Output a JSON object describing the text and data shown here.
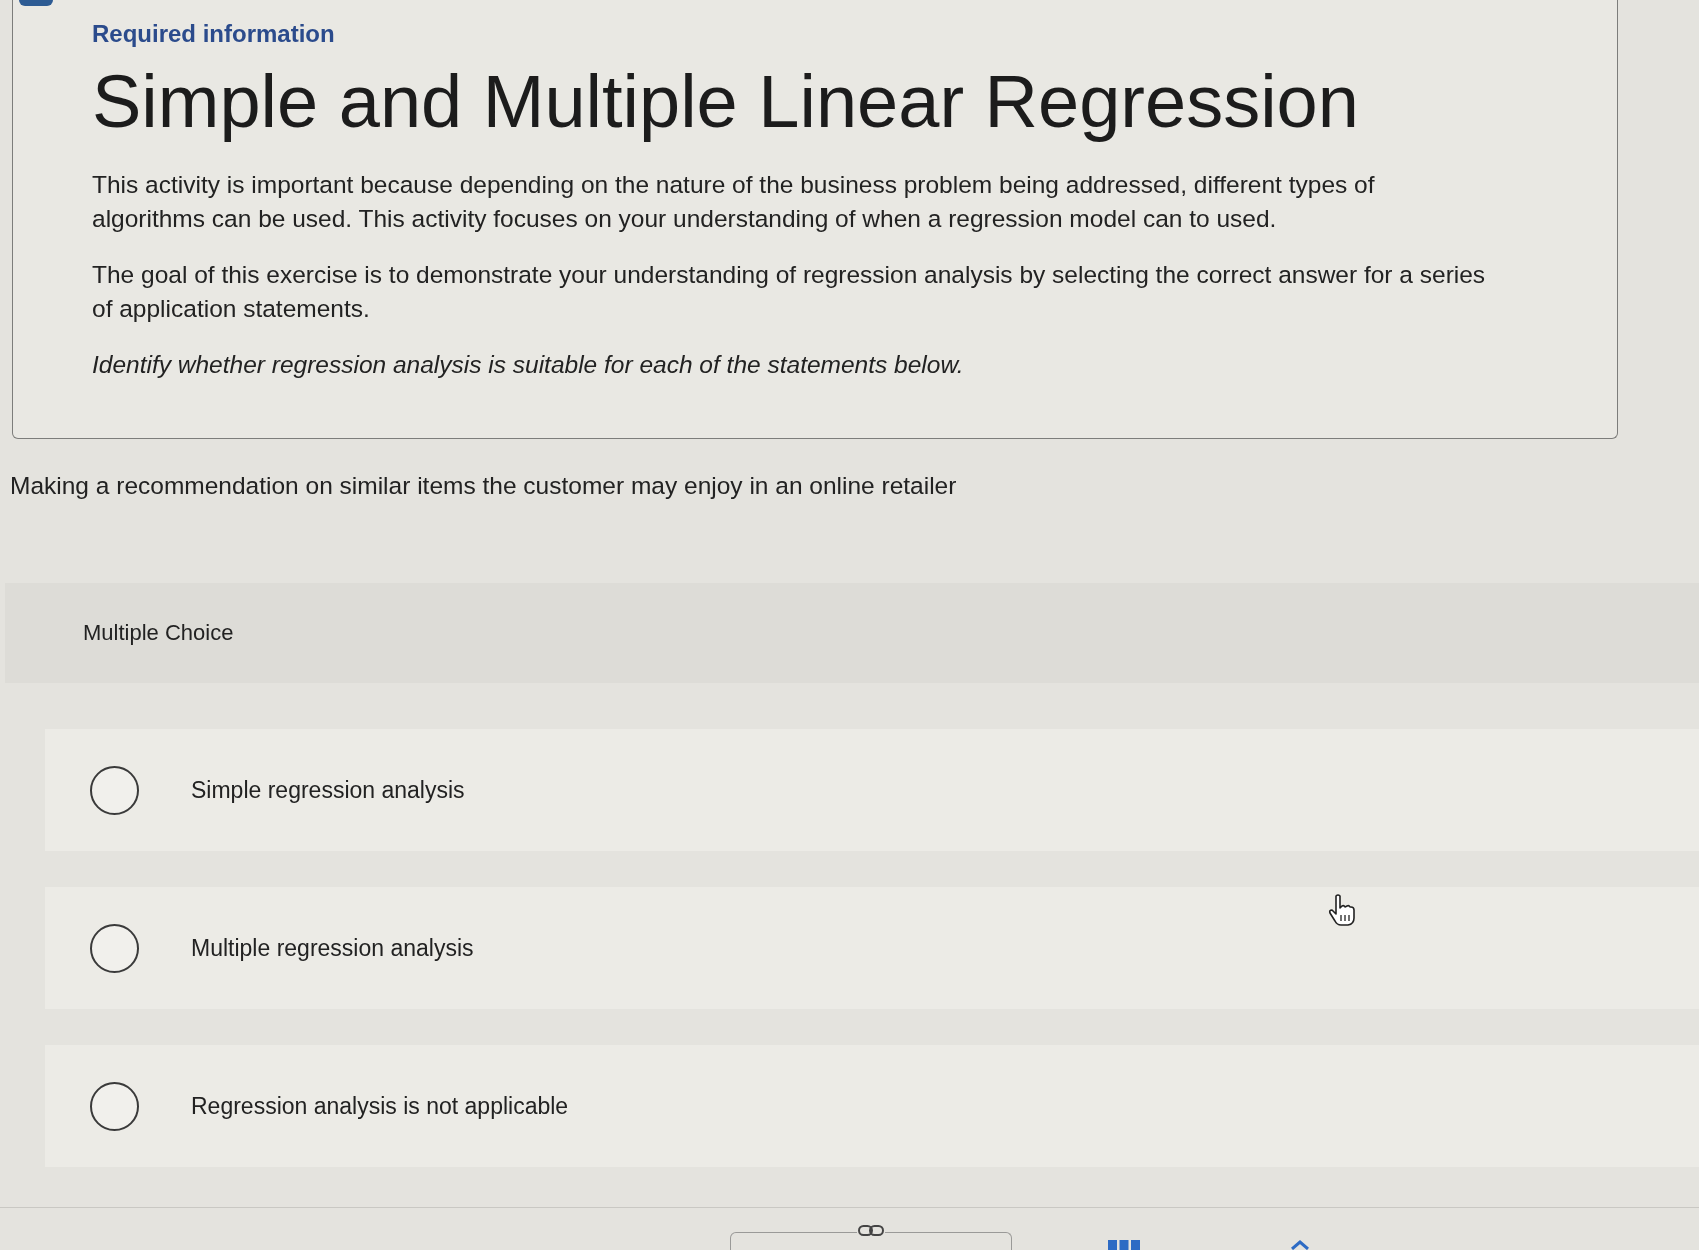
{
  "header": {
    "label": "Required information",
    "title": "Simple and Multiple Linear Regression",
    "paragraphs": [
      "This activity is important because depending on the nature of the business problem being addressed, different types of algorithms can be used. This activity focuses on your understanding of when a regression model can to used.",
      "The goal of this exercise is to demonstrate your understanding of regression analysis by selecting the correct answer for a series of application statements."
    ],
    "instruction": "Identify whether regression analysis is suitable for each of the statements below."
  },
  "question": {
    "prompt": "Making a recommendation on similar items the customer may enjoy in an online retailer",
    "type_label": "Multiple Choice",
    "options": [
      {
        "label": "Simple regression analysis",
        "selected": false
      },
      {
        "label": "Multiple regression analysis",
        "selected": false
      },
      {
        "label": "Regression analysis is not applicable",
        "selected": false
      }
    ]
  }
}
